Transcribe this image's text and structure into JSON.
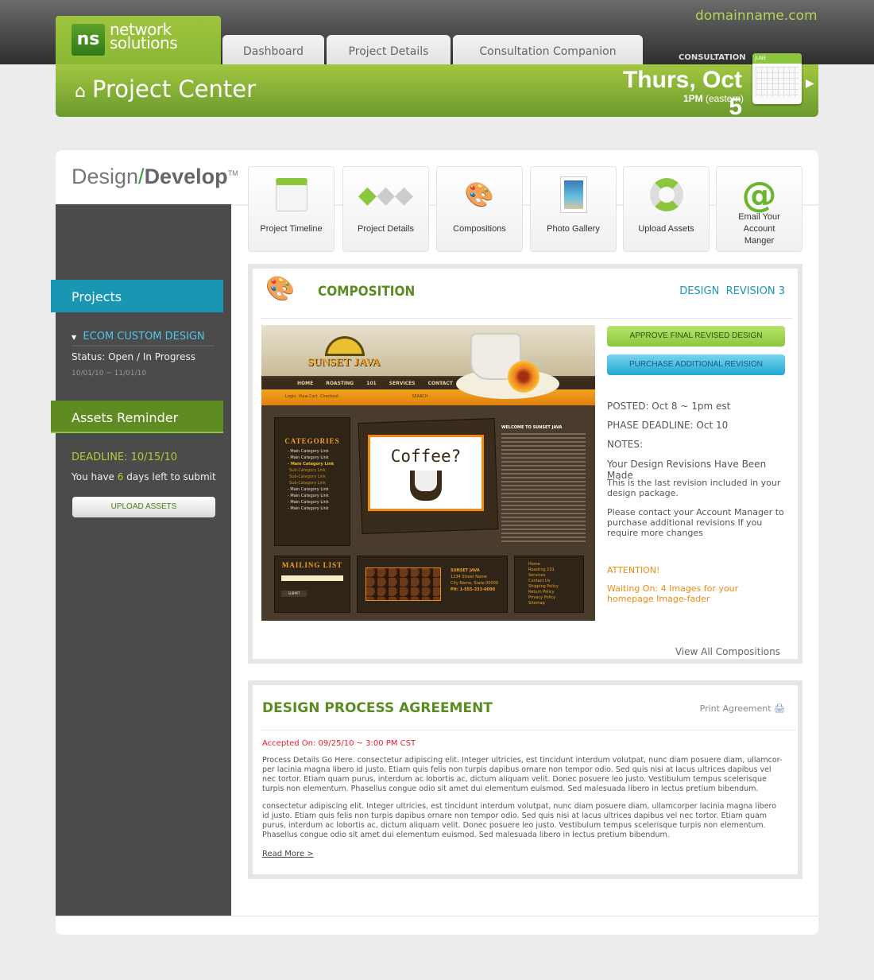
{
  "header": {
    "domain": "domainname.com",
    "logo": {
      "mark": "ns",
      "text_line1": "network",
      "text_line2": "solutions"
    },
    "tabs": [
      {
        "label": "Dashboard"
      },
      {
        "label": "Project Details"
      },
      {
        "label": "Consultation Companion"
      }
    ],
    "title": "Project Center",
    "title_icon": "home-icon",
    "consultation": {
      "label": "CONSULTATION",
      "date": "Thurs, Oct 5",
      "time_bold": "1PM",
      "time_zone": "(eastern)",
      "calendar_month": "JUNE"
    }
  },
  "brand": {
    "design": "Design",
    "slash": "/",
    "develop": "Develop",
    "tm": "TM"
  },
  "sidebar": {
    "projects_label": "Projects",
    "project": {
      "name": "ECOM CUSTOM DESIGN",
      "status": "Status: Open / In Progress",
      "dates": "10/01/10 ~ 11/01/10"
    },
    "assets_label": "Assets Reminder",
    "deadline": "DEADLINE: 10/15/10",
    "days_prefix": "You have ",
    "days_count": "6",
    "days_suffix": " days left to submit",
    "upload_button": "UPLOAD ASSETS"
  },
  "nav_cards": [
    {
      "label": "Project Timeline",
      "icon": "calendar-icon"
    },
    {
      "label": "Project Details",
      "icon": "flowchart-icon"
    },
    {
      "label": "Compositions",
      "icon": "palette-icon"
    },
    {
      "label": "Photo Gallery",
      "icon": "photo-icon"
    },
    {
      "label": "Upload Assets",
      "icon": "lifebuoy-icon"
    },
    {
      "label": "Email Your Account Manger",
      "icon": "at-sign-icon"
    }
  ],
  "composition": {
    "title": "COMPOSITION",
    "revision": "DESIGN  REVISION 3",
    "approve_button": "APPROVE FINAL REVISED DESIGN",
    "purchase_button": "PURCHASE ADDITIONAL REVISION",
    "posted": "POSTED: Oct 8 ~ 1pm est",
    "phase_deadline": "PHASE DEADLINE: Oct 10",
    "notes_label": "NOTES:",
    "notes_heading": "Your Design Revisions Have Been Made",
    "note1": "This is the last revision included in your design package.",
    "note2": "Please contact your Account Manager to purchase additional revisions If you require more changes",
    "attention": "ATTENTION!",
    "waiting": "Waiting On:  4 Images for your homepage Image-fader",
    "view_all": "View All Compositions",
    "mockup": {
      "brand": "SUNSET JAVA",
      "nav": "HOME ROASTING 101 SERVICES CONTACT US",
      "subnav": "Login  View Cart  Checkout                                                          SEARCH",
      "categories": "CATEGORIES",
      "links": [
        "- Main Category Link",
        "- Main Category Link",
        "- Main Category Link",
        "Sub-Category Link",
        "Sub-Category Link",
        "Sub-Category Link",
        "- Main Category Link",
        "- Main Category Link",
        "- Main Category Link",
        "- Main Category Link"
      ],
      "hero": "Coffee?",
      "welcome": "WELCOME TO SUNSET JAVA",
      "mailing": "MAILING LIST",
      "submit": "SUBMIT",
      "address": [
        "SUNSET JAVA",
        "1234 Street Name",
        "City Name, State 00000",
        "PH: 1-555-333-0000"
      ],
      "footer_links": [
        "Home",
        "Roasting 101",
        "Services",
        "Contact Us",
        "Shipping Policy",
        "Return Policy",
        "Privacy Policy",
        "Sitemap"
      ]
    }
  },
  "agreement": {
    "title": "DESIGN PROCESS AGREEMENT",
    "print": "Print Agreement",
    "accepted": "Accepted On:  09/25/10 ~ 3:00 PM CST",
    "para1": "Process Details Go Here. consectetur adipiscing elit. Integer ultricies, est tincidunt interdum volutpat, nunc diam posuere diam, ullamcor-per lacinia magna libero id justo. Etiam quis felis non turpis dapibus ornare non tempor odio. Sed quis nisi at lacus ultrices dapibus vel nec tortor. Etiam quam purus, interdum ac lobortis ac, dictum aliquam velit. Donec posuere leo justo. Vestibulum tempus scelerisque turpis non elementum. Phasellus congue odio sit amet dui elementum euismod. Sed malesuada libero in lectus pretium bibendum.",
    "para2": "consectetur adipiscing elit. Integer ultricies, est tincidunt interdum volutpat, nunc diam posuere diam, ullamcorper lacinia magna libero id justo. Etiam quis felis non turpis dapibus ornare non tempor odio. Sed quis nisi at lacus ultrices dapibus vel nec tortor. Etiam quam purus, interdum ac lobortis ac, dictum aliquam velit. Donec posuere leo justo. Vestibulum tempus scelerisque turpis non elementum. Phasellus congue odio sit amet dui elementum euismod. Sed malesuada libero in lectus pretium bibendum.",
    "read_more": "Read More >"
  },
  "colors": {
    "green": "#8cc63f",
    "blue": "#1996b2",
    "orange": "#f08a10",
    "red": "#e81c2c",
    "sidebar": "#4b4b4b"
  }
}
